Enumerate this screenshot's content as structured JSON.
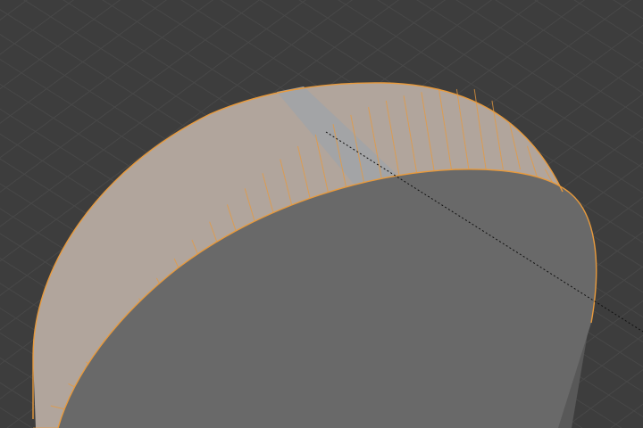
{
  "viewport": {
    "mode": "edit-mode-face-select",
    "background_color": "#3d3d3d",
    "grid_line_color": "#484848",
    "selection_color": "#e89a3c",
    "selected_face_color": "#b1a59c",
    "active_face_color": "#a3a4a6",
    "top_cap_color": "#696969",
    "shadow_side_color": "#585858",
    "mesh": {
      "object": "cylinder-mesh",
      "selected_faces": "side-ring",
      "active_face": "side-face-highlighted",
      "top_cap_selected": false
    },
    "pivot_guide": "dashed-line"
  }
}
